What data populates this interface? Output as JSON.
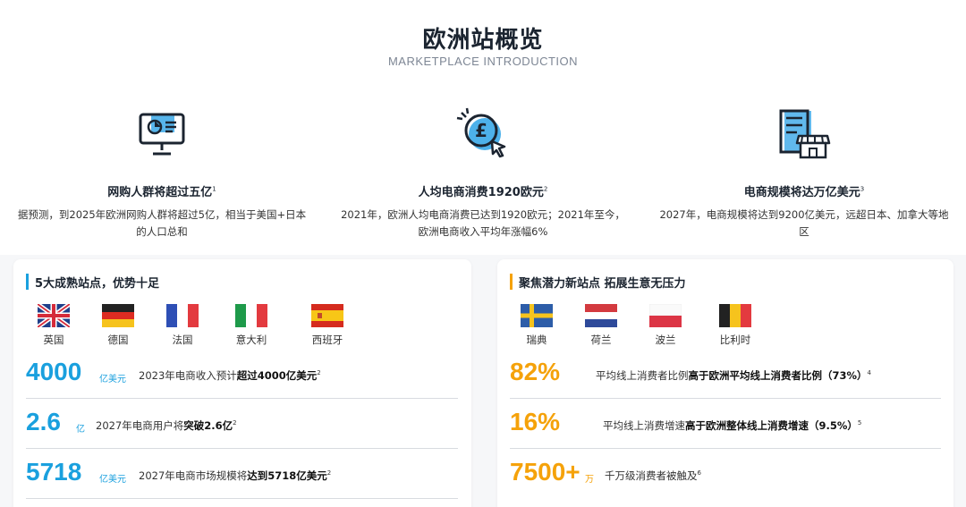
{
  "header": {
    "title": "欧洲站概览",
    "subtitle": "MARKETPLACE INTRODUCTION"
  },
  "features": [
    {
      "icon": "monitor-chart-icon",
      "title": "网购人群将超过五亿",
      "note": "1",
      "desc": "据预测，到2025年欧洲网购人群将超过5亿，相当于美国+日本的人口总和"
    },
    {
      "icon": "pound-coin-cursor-icon",
      "title": "人均电商消费1920欧元",
      "note": "2",
      "desc": "2021年，欧洲人均电商消费已达到1920欧元；2021年至今，欧洲电商收入平均年涨幅6%"
    },
    {
      "icon": "storefront-building-icon",
      "title": "电商规模将达万亿美元",
      "note": "3",
      "desc": "2027年，电商规模将达到9200亿美元，远超日本、加拿大等地区"
    }
  ],
  "left_card": {
    "title": "5大成熟站点，优势十足",
    "accent": "#1aa0de",
    "countries": [
      "英国",
      "德国",
      "法国",
      "意大利",
      "西班牙"
    ],
    "stats": [
      {
        "num": "4000",
        "unit": "亿美元",
        "pre": "2023年电商收入预计",
        "bold": "超过4000亿美元",
        "note": "2"
      },
      {
        "num": "2.6",
        "unit": "亿",
        "pre": "2027年电商用户将",
        "bold": "突破2.6亿",
        "note": "2"
      },
      {
        "num": "5718",
        "unit": "亿美元",
        "pre": "2027年电商市场规模将",
        "bold": "达到5718亿美元",
        "note": "2"
      }
    ]
  },
  "right_card": {
    "title": "聚焦潜力新站点 拓展生意无压力",
    "accent": "#f5a20a",
    "countries": [
      "瑞典",
      "荷兰",
      "波兰",
      "比利时"
    ],
    "stats": [
      {
        "num": "82%",
        "unit": "",
        "pre": "平均线上消费者比例",
        "bold": "高于欧洲平均线上消费者比例（73%）",
        "note": "4"
      },
      {
        "num": "16%",
        "unit": "",
        "pre": "平均线上消费增速",
        "bold": "高于欧洲整体线上消费增速（9.5%）",
        "note": "5"
      },
      {
        "num": "7500+",
        "unit": "万",
        "pre": "千万级消费者被触及",
        "bold": "",
        "note": "6"
      }
    ]
  }
}
